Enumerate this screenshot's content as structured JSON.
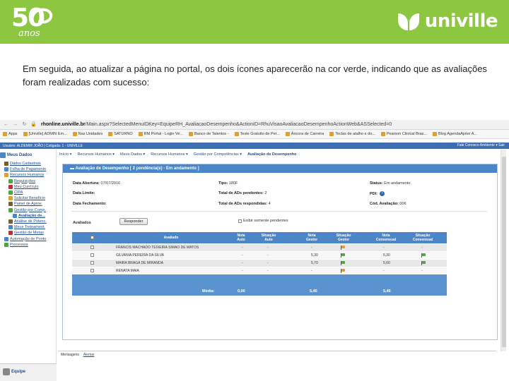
{
  "header": {
    "logo_number": "50",
    "logo_subtitle": "anos",
    "brand_name": "univille",
    "bg_color": "#8dc640"
  },
  "caption": "Em seguida, ao atualizar a página no portal, os dois ícones aparecerão na cor verde, indicando que as avaliações foram realizadas com sucesso:",
  "browser": {
    "url_host": "rhonline.univille.br",
    "url_path": "/Main.aspx?SelectedMenuIDKey=EquipeRH_AvaliacaoDesempenho&ActionID=RhuVisaoAvaliacaoDesempenhoActionWeb&ASSelected=0",
    "bookmarks": [
      "Apps",
      "[Univille] ADMIN Em...",
      "Nas Unidades",
      "SATURNO",
      "RM Portal - Login Ve...",
      "Banco de Talentos -",
      "Teste Gratuito de Per...",
      "Âncora de Carreira",
      "Teclas de atalho e do...",
      "Pearson Clinical Bras...",
      "Blog AgendaAjoter A..."
    ],
    "userbar": "Usuário: ALDEMIR JOÃO  |  Coligada: 1 - UNIVILLE",
    "userbar_right": "Fale Conosco   Ambiente ▾   Sair"
  },
  "tree": {
    "title": "Meus Dados",
    "items": [
      {
        "label": "Dados Cadastrais",
        "color": "#7b5a2c",
        "indent": 1
      },
      {
        "label": "Folha de Pagamento",
        "color": "#4a86c8",
        "indent": 1
      },
      {
        "label": "Recursos Humanos",
        "color": "#e0a030",
        "indent": 1
      },
      {
        "label": "Requisições",
        "color": "#4aa83c",
        "indent": 2
      },
      {
        "label": "Meu Currículo",
        "color": "#c03030",
        "indent": 2
      },
      {
        "label": "CIPA",
        "color": "#4aa83c",
        "indent": 2
      },
      {
        "label": "Solicitar Benefício",
        "color": "#e0a030",
        "indent": 2
      },
      {
        "label": "Painel de Aprov.",
        "color": "#7b5a2c",
        "indent": 2
      },
      {
        "label": "Gestão por Comp.",
        "color": "#4aa83c",
        "indent": 2
      },
      {
        "label": "Avaliação de...",
        "color": "#4a86c8",
        "indent": 3,
        "selected": true
      },
      {
        "label": "Análise de Potenc.",
        "color": "#7b5a2c",
        "indent": 2
      },
      {
        "label": "Meus Treinament.",
        "color": "#4a86c8",
        "indent": 2
      },
      {
        "label": "Gestão de Metas",
        "color": "#c03030",
        "indent": 2
      },
      {
        "label": "Automação de Ponto",
        "color": "#4a86c8",
        "indent": 1
      },
      {
        "label": "Processos",
        "color": "#4aa83c",
        "indent": 1
      }
    ],
    "bottom_label": "Equipe"
  },
  "menubar": {
    "items": [
      "Início ▾",
      "Recursos Humanos ▾",
      "Meus Dados ▾",
      "Recursos Humanos ▾",
      "Gestão por Competências ▾"
    ],
    "current": "Avaliação de Desempenho"
  },
  "panel": {
    "title": "Avaliação de Desempenho [ 2 pendência(s) - Em andamento ]",
    "fields": {
      "data_abertura_label": "Data Abertura:",
      "data_abertura_value": "07/07/2016",
      "tipo_label": "Tipo:",
      "tipo_value": "180F",
      "status_label": "Status:",
      "status_value": "Em andamento",
      "data_limite_label": "Data Limite:",
      "total_pend_label": "Total de ADs pendentes:",
      "total_pend_value": "2",
      "pdi_label": "PDI:",
      "data_fech_label": "Data Fechamento:",
      "total_resp_label": "Total de ADs respondidas:",
      "total_resp_value": "4",
      "cod_label": "Cód. Avaliação:",
      "cod_value": "006"
    },
    "avaliados_label": "Avaliados",
    "responder_label": "Responder",
    "exibir_label": "Exibir somente pendentes"
  },
  "table": {
    "headers": {
      "avaliado": "Avaliado",
      "nota_auto": "Nota\nAuto",
      "situacao_auto": "Situação\nAuto",
      "nota_gestor": "Nota\nGestor",
      "situacao_gestor": "Situação\nGestor",
      "nota_consensual": "Nota\nConsensual",
      "situacao_consensual": "Situação\nConsensual"
    },
    "rows": [
      {
        "name": "FRANCIS MACHADO TEIXEIRA SIMAO DE MATOS",
        "nota_auto": "-",
        "sit_auto": "-",
        "nota_gestor": "-",
        "sit_gestor": "orange",
        "nota_cons": "-",
        "sit_cons": "-"
      },
      {
        "name": "GILVANIA PEREIRA DA SILVA",
        "nota_auto": "-",
        "sit_auto": "-",
        "nota_gestor": "5,30",
        "sit_gestor": "green",
        "nota_cons": "5,30",
        "sit_cons": "green"
      },
      {
        "name": "MAIRA BRAGA DE MIRANDA",
        "nota_auto": "-",
        "sit_auto": "-",
        "nota_gestor": "5,70",
        "sit_gestor": "green",
        "nota_cons": "5,60",
        "sit_cons": "green"
      },
      {
        "name": "RENATA MAIA",
        "nota_auto": "-",
        "sit_auto": "-",
        "nota_gestor": "-",
        "sit_gestor": "orange",
        "nota_cons": "-",
        "sit_cons": "-"
      }
    ],
    "footer": {
      "label": "Média:",
      "auto": "0,00",
      "gestor": "5,45",
      "consensual": "5,45"
    }
  },
  "tabs": [
    "Mensagens",
    "Alertas"
  ]
}
